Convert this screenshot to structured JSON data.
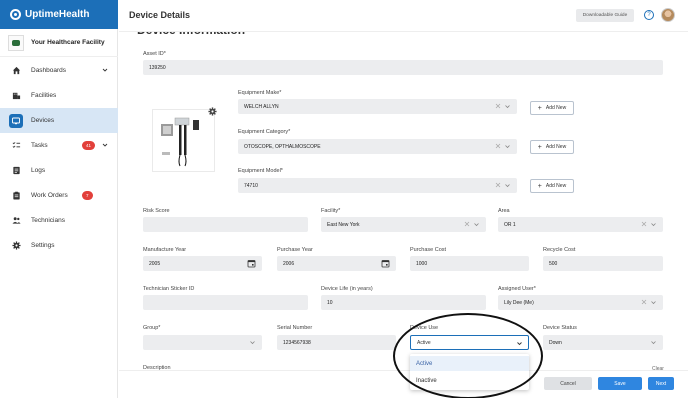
{
  "brand": {
    "name": "UptimeHealth"
  },
  "facility": {
    "name": "Your Healthcare Facility"
  },
  "sidebar": {
    "items": [
      {
        "label": "Dashboards"
      },
      {
        "label": "Facilities"
      },
      {
        "label": "Devices"
      },
      {
        "label": "Tasks",
        "badge": "41"
      },
      {
        "label": "Logs"
      },
      {
        "label": "Work Orders",
        "badge": "7"
      },
      {
        "label": "Technicians"
      },
      {
        "label": "Settings"
      }
    ]
  },
  "header": {
    "title": "Device Details",
    "guide_button": "Downloadable Guide",
    "help": "?"
  },
  "section": {
    "title": "Device Information"
  },
  "fields": {
    "asset_id": {
      "label": "Asset ID*",
      "value": "139250"
    },
    "equipment_make": {
      "label": "Equipment Make*",
      "value": "WELCH ALLYN"
    },
    "equipment_category": {
      "label": "Equipment Category*",
      "value": "OTOSCOPE, OPTHALMOSCOPE"
    },
    "equipment_model": {
      "label": "Equipment Model*",
      "value": "74710"
    },
    "risk_score": {
      "label": "Risk Score",
      "value": ""
    },
    "facility": {
      "label": "Facility*",
      "value": "East New York"
    },
    "area": {
      "label": "Area",
      "value": "OR 1"
    },
    "manufacture_year": {
      "label": "Manufacture Year",
      "value": "2005"
    },
    "purchase_year": {
      "label": "Purchase Year",
      "value": "2006"
    },
    "purchase_cost": {
      "label": "Purchase Cost",
      "value": "1000"
    },
    "recycle_cost": {
      "label": "Recycle Cost",
      "value": "500"
    },
    "technician_sticker_id": {
      "label": "Technician Sticker ID",
      "value": ""
    },
    "device_life": {
      "label": "Device Life (in years)",
      "value": "10"
    },
    "assigned_user": {
      "label": "Assigned User*",
      "value": "Lily Dee (Me)"
    },
    "group": {
      "label": "Group*",
      "value": ""
    },
    "serial_number": {
      "label": "Serial Number",
      "value": "1234567938"
    },
    "device_use": {
      "label": "Device Use",
      "value": "Active"
    },
    "device_status": {
      "label": "Device Status",
      "value": "Down"
    },
    "description": {
      "label": "Description"
    }
  },
  "add_new_label": "Add New",
  "dropdown": {
    "options": [
      "Active",
      "Inactive"
    ]
  },
  "footer": {
    "clear": "Clear",
    "cancel": "Cancel",
    "save": "Save",
    "next": "Next"
  },
  "colors": {
    "brand": "#1c6fb8",
    "active_nav": "#d7e6f5",
    "badge": "#e2403b",
    "primary_button": "#2f86e0"
  }
}
